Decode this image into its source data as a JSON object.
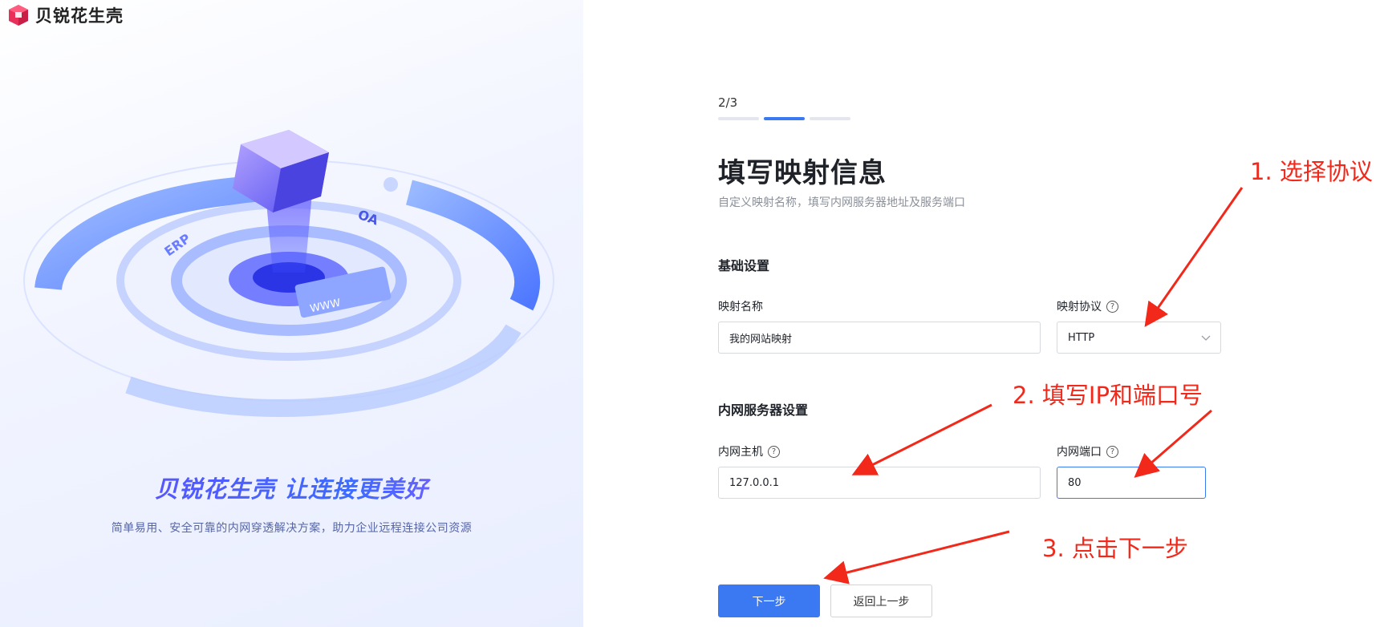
{
  "brand": {
    "logo_text": "贝锐花生壳",
    "slogan": "贝锐花生壳 让连接更美好",
    "subslogan": "简单易用、安全可靠的内网穿透解决方案，助力企业远程连接公司资源",
    "illustration_labels": {
      "erp": "ERP",
      "oa": "OA",
      "www": "WWW"
    }
  },
  "progress": {
    "text": "2/3",
    "current": 2,
    "total": 3
  },
  "page": {
    "title": "填写映射信息",
    "description": "自定义映射名称，填写内网服务器地址及服务端口"
  },
  "basic": {
    "section_title": "基础设置",
    "name_label": "映射名称",
    "name_value": "我的网站映射",
    "protocol_label": "映射协议",
    "protocol_value": "HTTP"
  },
  "intranet": {
    "section_title": "内网服务器设置",
    "host_label": "内网主机",
    "host_value": "127.0.0.1",
    "port_label": "内网端口",
    "port_value": "80"
  },
  "help_glyph": "?",
  "buttons": {
    "next": "下一步",
    "back": "返回上一步"
  },
  "annotations": {
    "step1": "1. 选择协议",
    "step2": "2. 填写IP和端口号",
    "step3": "3. 点击下一步"
  },
  "colors": {
    "primary": "#3b79f2",
    "annotation_red": "#f1281a",
    "logo_pink": "#e8305a"
  }
}
